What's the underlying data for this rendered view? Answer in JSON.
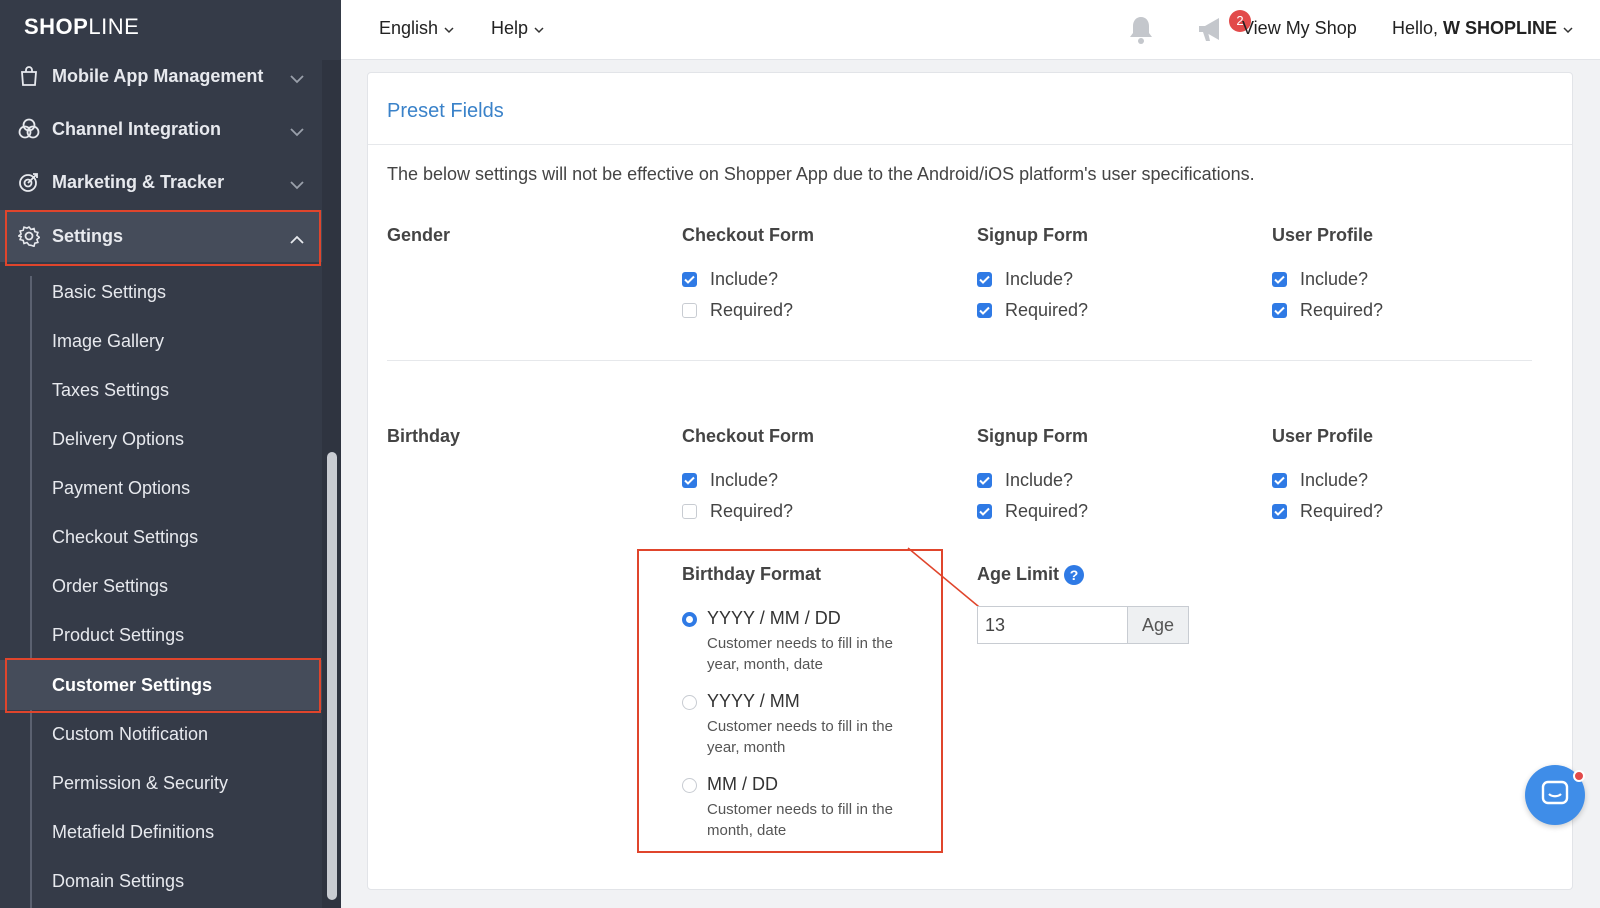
{
  "app": {
    "logo_bold": "SHOP",
    "logo_rest": "LINE"
  },
  "sidebar": {
    "groups": [
      {
        "label": "Mobile App Management",
        "icon": "bag-icon"
      },
      {
        "label": "Channel Integration",
        "icon": "channels-icon"
      },
      {
        "label": "Marketing & Tracker",
        "icon": "target-icon"
      },
      {
        "label": "Settings",
        "icon": "gear-icon",
        "expanded": true
      }
    ],
    "items": [
      {
        "label": "Basic Settings"
      },
      {
        "label": "Image Gallery"
      },
      {
        "label": "Taxes Settings"
      },
      {
        "label": "Delivery Options"
      },
      {
        "label": "Payment Options"
      },
      {
        "label": "Checkout Settings"
      },
      {
        "label": "Order Settings"
      },
      {
        "label": "Product Settings"
      },
      {
        "label": "Customer Settings",
        "active": true
      },
      {
        "label": "Custom Notification"
      },
      {
        "label": "Permission & Security"
      },
      {
        "label": "Metafield Definitions"
      },
      {
        "label": "Domain Settings"
      }
    ]
  },
  "topbar": {
    "language": "English",
    "help": "Help",
    "notification_count": "2",
    "view_shop": "View My Shop",
    "hello": "Hello,",
    "user": "W SHOPLINE"
  },
  "card": {
    "title": "Preset Fields",
    "notice": "The below settings will not be effective on Shopper App due to the Android/iOS platform's user specifications.",
    "columns": [
      "Checkout Form",
      "Signup Form",
      "User Profile"
    ],
    "include_label": "Include?",
    "required_label": "Required?",
    "fields": [
      {
        "label": "Gender",
        "checkout": {
          "include": true,
          "required": false
        },
        "signup": {
          "include": true,
          "required": true
        },
        "profile": {
          "include": true,
          "required": true
        }
      },
      {
        "label": "Birthday",
        "checkout": {
          "include": true,
          "required": false
        },
        "signup": {
          "include": true,
          "required": true
        },
        "profile": {
          "include": true,
          "required": true
        }
      }
    ],
    "birthday_format": {
      "title": "Birthday Format",
      "options": [
        {
          "label": "YYYY / MM / DD",
          "desc": "Customer needs to fill in the year, month, date",
          "selected": true
        },
        {
          "label": "YYYY / MM",
          "desc": "Customer needs to fill in the year, month",
          "selected": false
        },
        {
          "label": "MM / DD",
          "desc": "Customer needs to fill in the month, date",
          "selected": false
        }
      ]
    },
    "age_limit": {
      "title": "Age Limit",
      "value": "13",
      "addon": "Age"
    }
  },
  "colors": {
    "accent": "#2f7ae5",
    "sidebar_bg": "#353b48",
    "highlight": "#e0452c",
    "title_blue": "#3a82c9"
  }
}
